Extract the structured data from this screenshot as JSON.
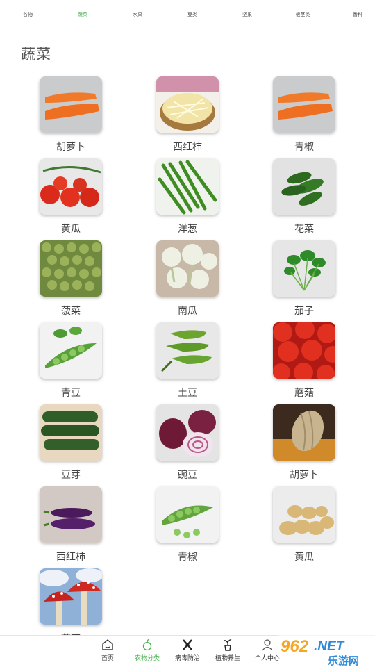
{
  "top_tabs": [
    {
      "label": "谷物",
      "active": false
    },
    {
      "label": "蔬菜",
      "active": true
    },
    {
      "label": "水果",
      "active": false
    },
    {
      "label": "豆类",
      "active": false
    },
    {
      "label": "坚果",
      "active": false
    },
    {
      "label": "根茎类",
      "active": false
    },
    {
      "label": "香料",
      "active": false
    }
  ],
  "section_title": "蔬菜",
  "items": [
    {
      "label": "胡萝卜",
      "image": "carrot"
    },
    {
      "label": "西红柿",
      "image": "bean-sprouts"
    },
    {
      "label": "青椒",
      "image": "carrot"
    },
    {
      "label": "黄瓜",
      "image": "cherry-tomatoes"
    },
    {
      "label": "洋葱",
      "image": "green-beans"
    },
    {
      "label": "花菜",
      "image": "small-cucumbers"
    },
    {
      "label": "菠菜",
      "image": "peas"
    },
    {
      "label": "南瓜",
      "image": "cauliflower"
    },
    {
      "label": "茄子",
      "image": "spinach"
    },
    {
      "label": "青豆",
      "image": "pea-pods"
    },
    {
      "label": "土豆",
      "image": "green-peppers"
    },
    {
      "label": "蘑菇",
      "image": "tomatoes"
    },
    {
      "label": "豆芽",
      "image": "cucumbers"
    },
    {
      "label": "豌豆",
      "image": "red-onion"
    },
    {
      "label": "胡萝卜",
      "image": "pumpkin"
    },
    {
      "label": "西红柿",
      "image": "eggplant"
    },
    {
      "label": "青椒",
      "image": "pea-pods-small"
    },
    {
      "label": "黄瓜",
      "image": "potatoes"
    },
    {
      "label": "蘑菇",
      "image": "mushroom"
    }
  ],
  "bottom_nav": [
    {
      "label": "首页",
      "icon": "home-icon",
      "active": false
    },
    {
      "label": "农物分类",
      "icon": "sprout-icon",
      "active": true
    },
    {
      "label": "病毒防治",
      "icon": "virus-protection-icon",
      "active": false
    },
    {
      "label": "植物养生",
      "icon": "plant-pot-icon",
      "active": false
    },
    {
      "label": "个人中心",
      "icon": "user-icon",
      "active": false
    }
  ],
  "watermark": {
    "brand": "962.NET",
    "sub": "乐游网"
  },
  "colors": {
    "accent": "#4caf50",
    "text": "#444444"
  }
}
